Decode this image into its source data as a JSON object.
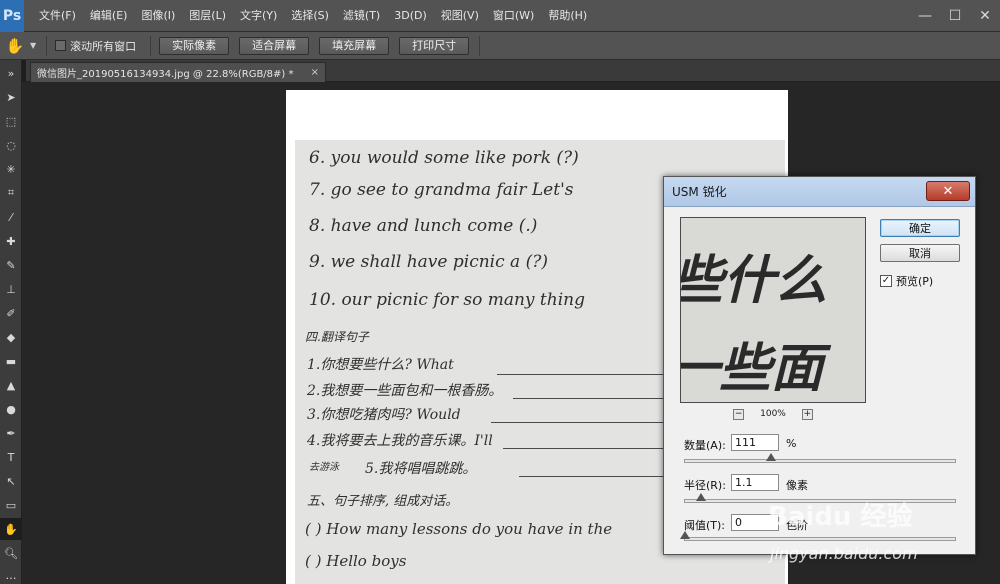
{
  "app": {
    "logo": "Ps"
  },
  "menu": [
    "文件(F)",
    "编辑(E)",
    "图像(I)",
    "图层(L)",
    "文字(Y)",
    "选择(S)",
    "滤镜(T)",
    "3D(D)",
    "视图(V)",
    "窗口(W)",
    "帮助(H)"
  ],
  "window_controls": {
    "minimize": "—",
    "maximize": "☐",
    "close": "✕"
  },
  "options_bar": {
    "scroll_all_label": "滚动所有窗口",
    "buttons": [
      "实际像素",
      "适合屏幕",
      "填充屏幕",
      "打印尺寸"
    ]
  },
  "document_tab": {
    "title": "微信图片_20190516134934.jpg @ 22.8%(RGB/8#) *",
    "close": "×"
  },
  "tools": [
    "move",
    "marquee",
    "lasso",
    "quick-select",
    "crop",
    "eyedropper",
    "healing",
    "brush",
    "stamp",
    "history-brush",
    "eraser",
    "gradient",
    "blur",
    "dodge",
    "pen",
    "type",
    "path-select",
    "shape",
    "hand",
    "zoom"
  ],
  "handwriting": {
    "lines": [
      "6. you   would   some   like  pork  (?)",
      "7. go   see   to   grandma  fair   Let's",
      "8. have   and   lunch   come  (.)",
      "9. we   shall   have   picnic   a   (?)",
      "10.  our   picnic   for   so many   thing",
      "四.翻译句子",
      "1.你想要些什么?  What",
      "2.我想要一些面包和一根香肠。",
      "3.你想吃猪肉吗? Would",
      "4.我将要去上我的音乐课。I'll",
      "去游泳",
      "5.我将唱唱跳跳。",
      "五、句子排序, 组成对话。",
      "(   )   How  many  lessons  do you  have  in the",
      "(   )   Hello  boys"
    ]
  },
  "usm_dialog": {
    "title": "USM 锐化",
    "close": "✕",
    "ok_label": "确定",
    "cancel_label": "取消",
    "preview_label": "预览(P)",
    "preview_checked": true,
    "preview_text_top": "些什么",
    "preview_text_bottom": "一些面",
    "zoom_out": "−",
    "zoom_in": "+",
    "zoom_level": "100%",
    "amount": {
      "label": "数量(A):",
      "value": "111",
      "unit": "%",
      "slider_position": 0.32
    },
    "radius": {
      "label": "半径(R):",
      "value": "1.1",
      "unit": "像素",
      "slider_position": 0.06
    },
    "threshold": {
      "label": "阈值(T):",
      "value": "0",
      "unit": "色阶",
      "slider_position": 0.0
    }
  },
  "watermark": {
    "logo": "Baidu 经验",
    "url": "jingyan.baidu.com"
  }
}
